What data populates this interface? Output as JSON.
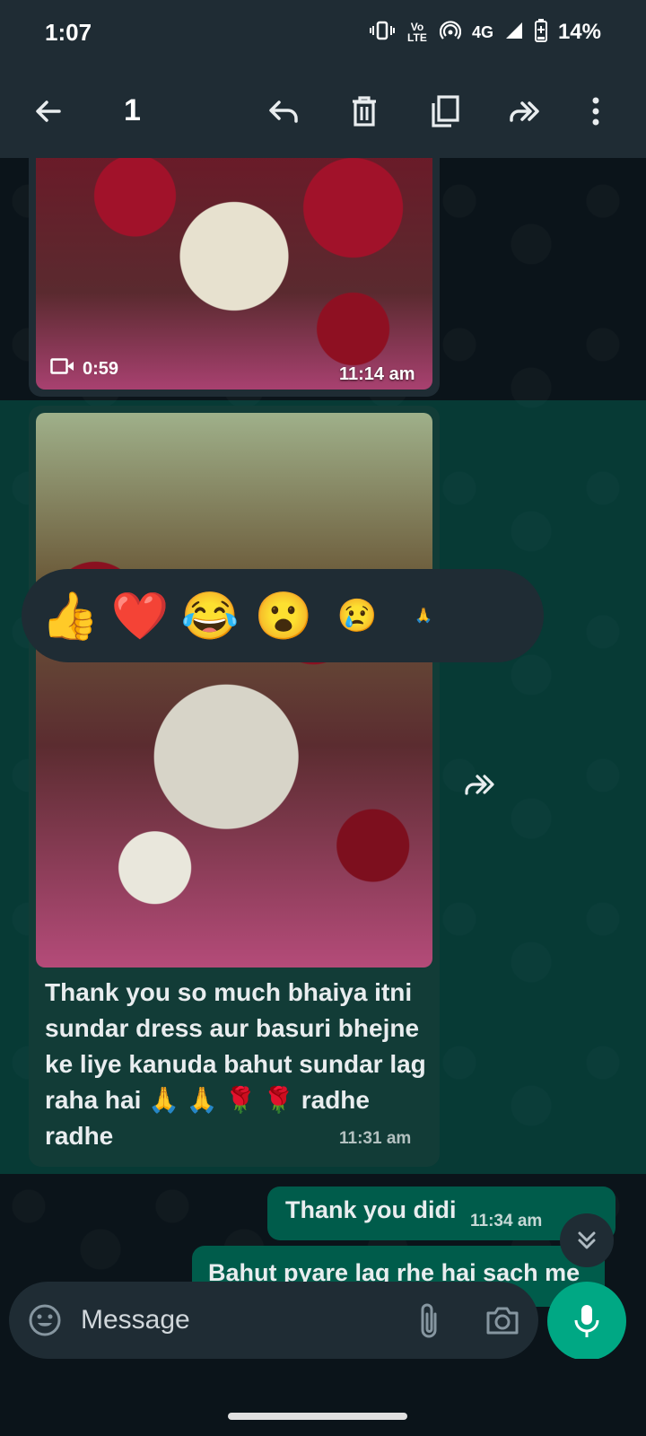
{
  "status_bar": {
    "time": "1:07",
    "network": "4G",
    "volte": "Vo LTE",
    "battery": "14%"
  },
  "toolbar": {
    "selected_count": "1",
    "icons": [
      "back-arrow-icon",
      "reply-icon",
      "delete-icon",
      "copy-icon",
      "forward-icon",
      "more-icon"
    ]
  },
  "messages": {
    "video": {
      "duration": "0:59",
      "time": "11:14 am"
    },
    "photo": {
      "caption": "Thank you so much bhaiya itni sundar dress aur basuri  bhejne ke liye kanuda bahut sundar lag raha hai 🙏 🙏 🌹 🌹  radhe radhe",
      "time": "11:31 am"
    },
    "out1": {
      "text": "Thank you didi",
      "time": "11:34 am"
    },
    "out2": {
      "text": "Bahut pyare lag rhe hai sach me"
    }
  },
  "reactions": [
    "👍",
    "❤️",
    "😂",
    "😮",
    "😢",
    "🙏"
  ],
  "composer": {
    "placeholder": "Message"
  },
  "colors": {
    "accent": "#00a884",
    "bubble_out": "#005c4b",
    "bubble_in": "#1f2c34",
    "selection": "#008069"
  }
}
